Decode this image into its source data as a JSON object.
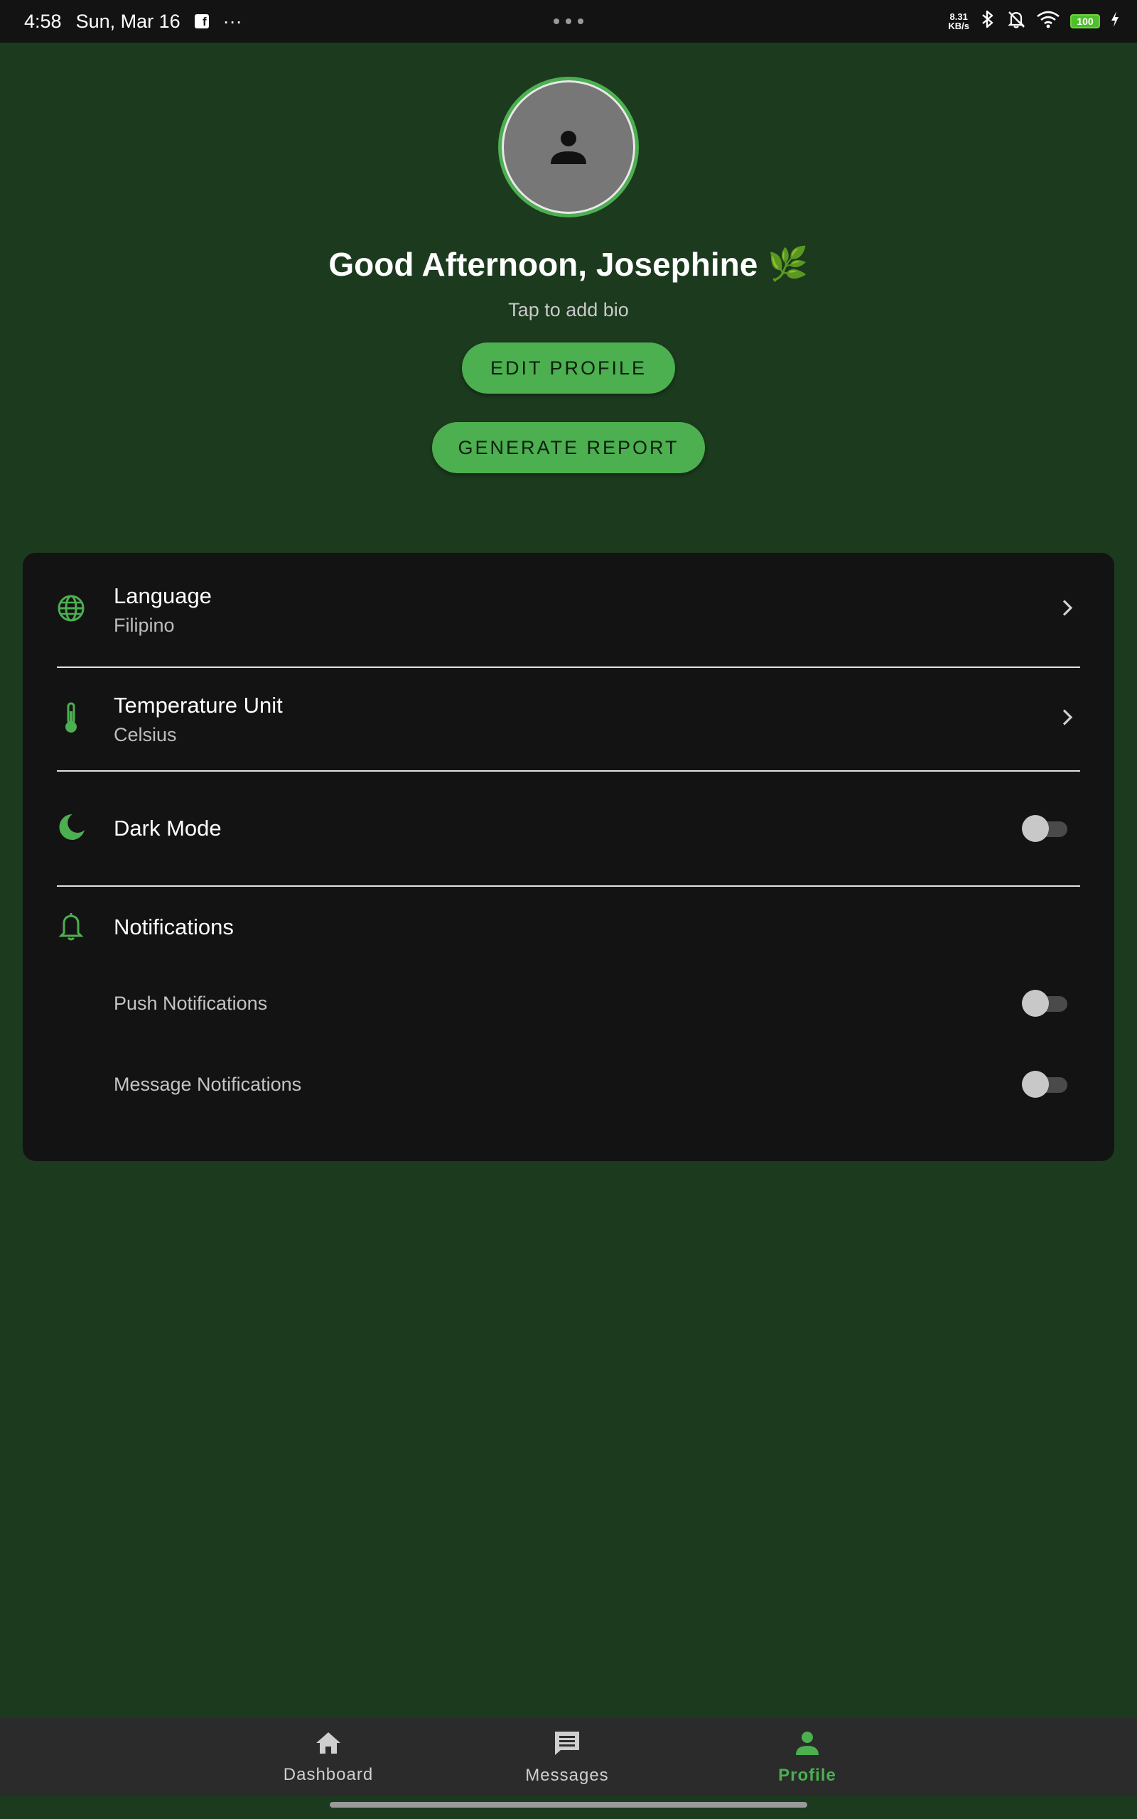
{
  "status_bar": {
    "time": "4:58",
    "date": "Sun, Mar 16",
    "more": "···",
    "net_speed_value": "8.31",
    "net_speed_unit": "KB/s",
    "battery": "100"
  },
  "profile": {
    "greeting": "Good Afternoon, Josephine",
    "greeting_emoji": "🌿",
    "bio_placeholder": "Tap to add bio",
    "edit_button": "EDIT PROFILE",
    "report_button": "GENERATE REPORT"
  },
  "settings": {
    "language": {
      "title": "Language",
      "value": "Filipino"
    },
    "temperature": {
      "title": "Temperature Unit",
      "value": "Celsius"
    },
    "dark_mode": {
      "title": "Dark Mode",
      "enabled": false
    },
    "notifications": {
      "title": "Notifications",
      "push": {
        "label": "Push Notifications",
        "enabled": false
      },
      "message": {
        "label": "Message Notifications",
        "enabled": false
      }
    }
  },
  "bottom_nav": {
    "items": [
      {
        "label": "Dashboard",
        "icon": "home-icon",
        "active": false
      },
      {
        "label": "Messages",
        "icon": "message-icon",
        "active": false
      },
      {
        "label": "Profile",
        "icon": "person-icon",
        "active": true
      }
    ]
  },
  "colors": {
    "background": "#1c3a1e",
    "accent": "#4caf50",
    "card": "#131313",
    "nav": "#2b2b2b"
  }
}
